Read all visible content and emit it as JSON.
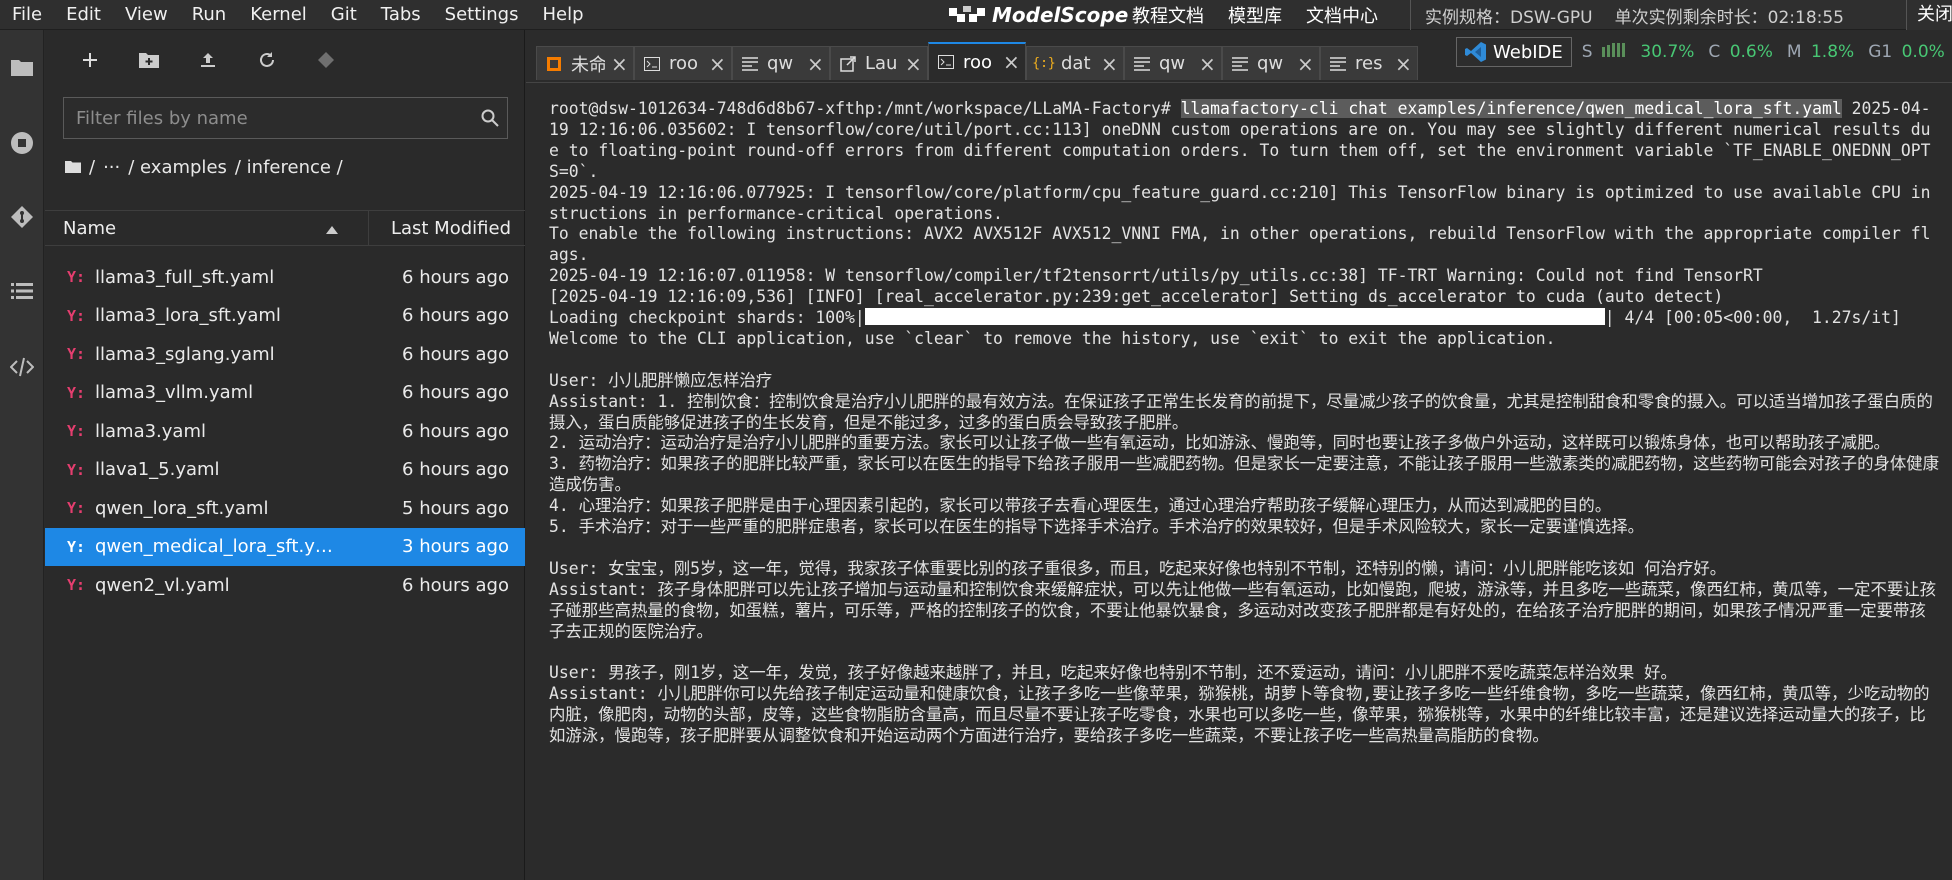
{
  "menu": [
    "File",
    "Edit",
    "View",
    "Run",
    "Kernel",
    "Git",
    "Tabs",
    "Settings",
    "Help"
  ],
  "brand": {
    "name": "ModelScope"
  },
  "top_links": [
    "教程文档",
    "模型库",
    "文档中心"
  ],
  "instance": {
    "spec": "实例规格：DSW-GPU",
    "remaining": "单次实例剩余时长：02:18:55"
  },
  "close_label": "关闭",
  "file_browser": {
    "search_placeholder": "Filter files by name",
    "breadcrumb": [
      "/",
      "···",
      "/ examples",
      "/ inference /"
    ],
    "col_name": "Name",
    "col_modified": "Last Modified",
    "files": [
      {
        "name": "llama3_full_sft.yaml",
        "modified": "6 hours ago",
        "selected": false
      },
      {
        "name": "llama3_lora_sft.yaml",
        "modified": "6 hours ago",
        "selected": false
      },
      {
        "name": "llama3_sglang.yaml",
        "modified": "6 hours ago",
        "selected": false
      },
      {
        "name": "llama3_vllm.yaml",
        "modified": "6 hours ago",
        "selected": false
      },
      {
        "name": "llama3.yaml",
        "modified": "6 hours ago",
        "selected": false
      },
      {
        "name": "llava1_5.yaml",
        "modified": "6 hours ago",
        "selected": false
      },
      {
        "name": "qwen_lora_sft.yaml",
        "modified": "5 hours ago",
        "selected": false
      },
      {
        "name": "qwen_medical_lora_sft.ya...",
        "modified": "3 hours ago",
        "selected": true
      },
      {
        "name": "qwen2_vl.yaml",
        "modified": "6 hours ago",
        "selected": false
      }
    ]
  },
  "tabs": [
    {
      "label": "未命",
      "icon": "notebook-icon",
      "active": false
    },
    {
      "label": "roo",
      "icon": "terminal-icon",
      "active": false
    },
    {
      "label": "qw",
      "icon": "text-file-icon",
      "active": false
    },
    {
      "label": "Lau",
      "icon": "launcher-icon",
      "active": false
    },
    {
      "label": "roo",
      "icon": "terminal-icon",
      "active": true
    },
    {
      "label": "dat",
      "icon": "json-icon",
      "active": false
    },
    {
      "label": "qw",
      "icon": "text-file-icon",
      "active": false
    },
    {
      "label": "qw",
      "icon": "text-file-icon",
      "active": false
    },
    {
      "label": "res",
      "icon": "text-file-icon",
      "active": false
    }
  ],
  "webide": {
    "label": "WebIDE"
  },
  "metrics": [
    {
      "label": "S",
      "value": "30.7%"
    },
    {
      "label": "C",
      "value": "0.6%"
    },
    {
      "label": "M",
      "value": "1.8%"
    },
    {
      "label": "G1",
      "value": "0.0%"
    }
  ],
  "colors": {
    "accent": "#1e88e5",
    "yaml_icon": "#e53e6f",
    "metric_ok": "#48c774"
  },
  "terminal": {
    "prompt": "root@dsw-1012634-748d6d8b67-xfthp:/mnt/workspace/LLaMA-Factory# ",
    "command": "llamafactory-cli chat examples/inference/qwen_medical_lora_sft.yaml",
    "log1": " 2025-04-19 12:16:06.035602: I tensorflow/core/util/port.cc:113] oneDNN custom operations are on. You may see slightly different numerical results due to floating-point round-off errors from different computation orders. To turn them off, set the environment variable `TF_ENABLE_ONEDNN_OPTS=0`.",
    "log2": "2025-04-19 12:16:06.077925: I tensorflow/core/platform/cpu_feature_guard.cc:210] This TensorFlow binary is optimized to use available CPU instructions in performance-critical operations.",
    "log3": "To enable the following instructions: AVX2 AVX512F AVX512_VNNI FMA, in other operations, rebuild TensorFlow with the appropriate compiler flags.",
    "log4": "2025-04-19 12:16:07.011958: W tensorflow/compiler/tf2tensorrt/utils/py_utils.cc:38] TF-TRT Warning: Could not find TensorRT",
    "log5": "[2025-04-19 12:16:09,536] [INFO] [real_accelerator.py:239:get_accelerator] Setting ds_accelerator to cuda (auto detect)",
    "loading_prefix": "Loading checkpoint shards: 100%|",
    "loading_suffix": "| 4/4 [00:05<00:00,  1.27s/it]",
    "loading_progress": 1.0,
    "welcome": "Welcome to the CLI application, use `clear` to remove the history, use `exit` to exit the application.",
    "q1": "User: 小儿肥胖懒应怎样治疗",
    "a1_1": "Assistant: 1. 控制饮食：控制饮食是治疗小儿肥胖的最有效方法。在保证孩子正常生长发育的前提下，尽量减少孩子的饮食量，尤其是控制甜食和零食的摄入。可以适当增加孩子蛋白质的摄入，蛋白质能够促进孩子的生长发育，但是不能过多，过多的蛋白质会导致孩子肥胖。",
    "a1_2": "2. 运动治疗：运动治疗是治疗小儿肥胖的重要方法。家长可以让孩子做一些有氧运动，比如游泳、慢跑等，同时也要让孩子多做户外运动，这样既可以锻炼身体，也可以帮助孩子减肥。",
    "a1_3": "3. 药物治疗：如果孩子的肥胖比较严重，家长可以在医生的指导下给孩子服用一些减肥药物。但是家长一定要注意，不能让孩子服用一些激素类的减肥药物，这些药物可能会对孩子的身体健康造成伤害。",
    "a1_4": "4. 心理治疗：如果孩子肥胖是由于心理因素引起的，家长可以带孩子去看心理医生，通过心理治疗帮助孩子缓解心理压力，从而达到减肥的目的。",
    "a1_5": "5. 手术治疗：对于一些严重的肥胖症患者，家长可以在医生的指导下选择手术治疗。手术治疗的效果较好，但是手术风险较大，家长一定要谨慎选择。",
    "q2": "User: 女宝宝，刚5岁，这一年，觉得，我家孩子体重要比别的孩子重很多，而且，吃起来好像也特别不节制，还特别的懒，请问：小儿肥胖能吃该如 何治疗好。",
    "a2": "Assistant: 孩子身体肥胖可以先让孩子增加与运动量和控制饮食来缓解症状，可以先让他做一些有氧运动，比如慢跑，爬坡，游泳等，并且多吃一些蔬菜，像西红柿，黄瓜等，一定不要让孩子碰那些高热量的食物，如蛋糕，薯片，可乐等，严格的控制孩子的饮食，不要让他暴饮暴食，多运动对改变孩子肥胖都是有好处的，在给孩子治疗肥胖的期间，如果孩子情况严重一定要带孩子去正规的医院治疗。",
    "q3": "User: 男孩子，刚1岁，这一年，发觉，孩子好像越来越胖了，并且，吃起来好像也特别不节制，还不爱运动，请问：小儿肥胖不爱吃蔬菜怎样治效果 好。",
    "a3": "Assistant: 小儿肥胖你可以先给孩子制定运动量和健康饮食，让孩子多吃一些像苹果，猕猴桃，胡萝卜等食物,要让孩子多吃一些纤维食物，多吃一些蔬菜，像西红柿，黄瓜等，少吃动物的内脏，像肥肉，动物的头部，皮等，这些食物脂肪含量高，而且尽量不要让孩子吃零食，水果也可以多吃一些，像苹果，猕猴桃等，水果中的纤维比较丰富，还是建议选择运动量大的孩子，比如游泳，慢跑等，孩子肥胖要从调整饮食和开始运动两个方面进行治疗，要给孩子多吃一些蔬菜，不要让孩子吃一些高热量高脂肪的食物。"
  }
}
